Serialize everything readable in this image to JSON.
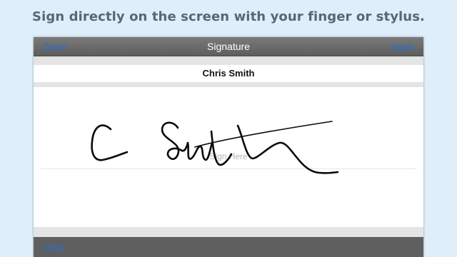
{
  "headline": "Sign directly on the screen with your finger or stylus.",
  "navbar": {
    "title": "Signature",
    "close_label": "Close",
    "apply_label": "Apply"
  },
  "signer_name": "Chris Smith",
  "sign_hint": "Sign Here",
  "toolbar": {
    "clear_label": "Clear"
  },
  "colors": {
    "page_background": "#deeefa",
    "link_blue": "#1f72d6",
    "navbar_gray": "#6b6b6b",
    "ink": "#0a0a0a"
  }
}
